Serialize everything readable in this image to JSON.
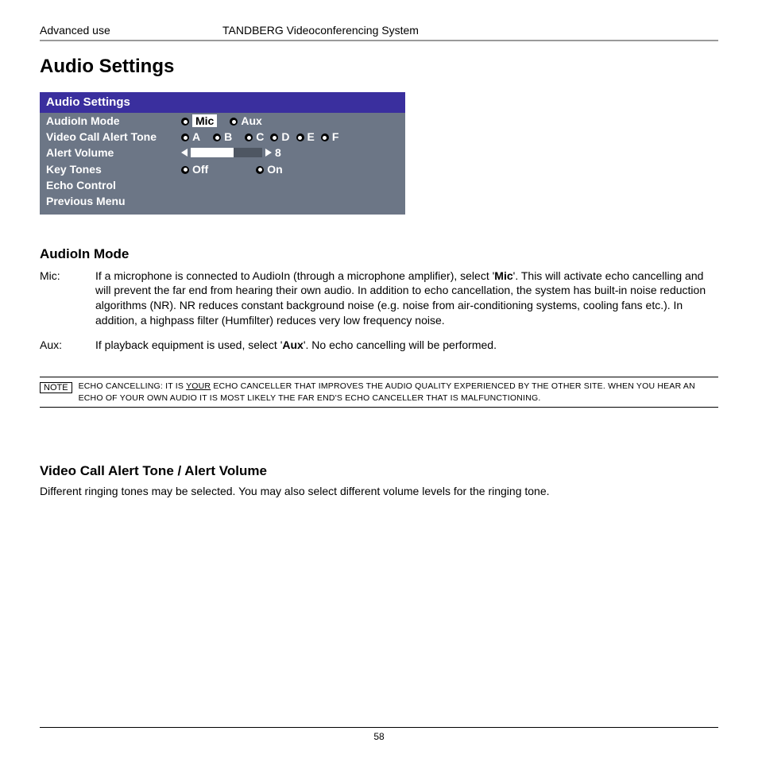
{
  "header": {
    "section": "Advanced use",
    "title": "TANDBERG Videoconferencing System"
  },
  "title": "Audio Settings",
  "panel": {
    "title": "Audio Settings",
    "rows": [
      {
        "label": "AudioIn Mode",
        "options": [
          "Mic",
          "Aux"
        ],
        "selected": "Mic"
      },
      {
        "label": "Video Call Alert Tone",
        "options": [
          "A",
          "B",
          "C",
          "D",
          "E",
          "F"
        ]
      },
      {
        "label": "Alert Volume",
        "value": "8"
      },
      {
        "label": "Key Tones",
        "options": [
          "Off",
          "On"
        ]
      },
      {
        "label": "Echo Control"
      },
      {
        "label": "Previous Menu"
      }
    ]
  },
  "sections": [
    {
      "heading": "AudioIn Mode",
      "items": [
        {
          "term": "Mic:",
          "pre": "If a microphone is connected to AudioIn (through a microphone amplifier), select ",
          "bold": "Mic",
          "post": ". This will activate echo cancelling and will prevent the far end from hearing their own audio. In addition to echo cancellation, the system has built-in noise reduction algorithms (NR). NR reduces constant background noise (e.g. noise from air-conditioning systems, cooling fans etc.). In addition, a highpass filter (Humfilter) reduces very low frequency noise."
        },
        {
          "term": "Aux:",
          "pre": "If playback equipment is used, select ",
          "bold": "Aux",
          "post": ". No echo cancelling will be performed."
        }
      ]
    },
    {
      "heading": "Video Call Alert Tone / Alert Volume",
      "body": "Different ringing tones may be selected. You may also select different volume levels for the ringing tone."
    }
  ],
  "note": {
    "label": "NOTE",
    "pre": "Echo Cancelling: It is",
    "underline": "your",
    "post": "echo canceller that improves the audio quality experienced by the other site. When you hear an echo of your own audio it is most likely the far end's echo canceller that is malfunctioning."
  },
  "page_number": "58"
}
